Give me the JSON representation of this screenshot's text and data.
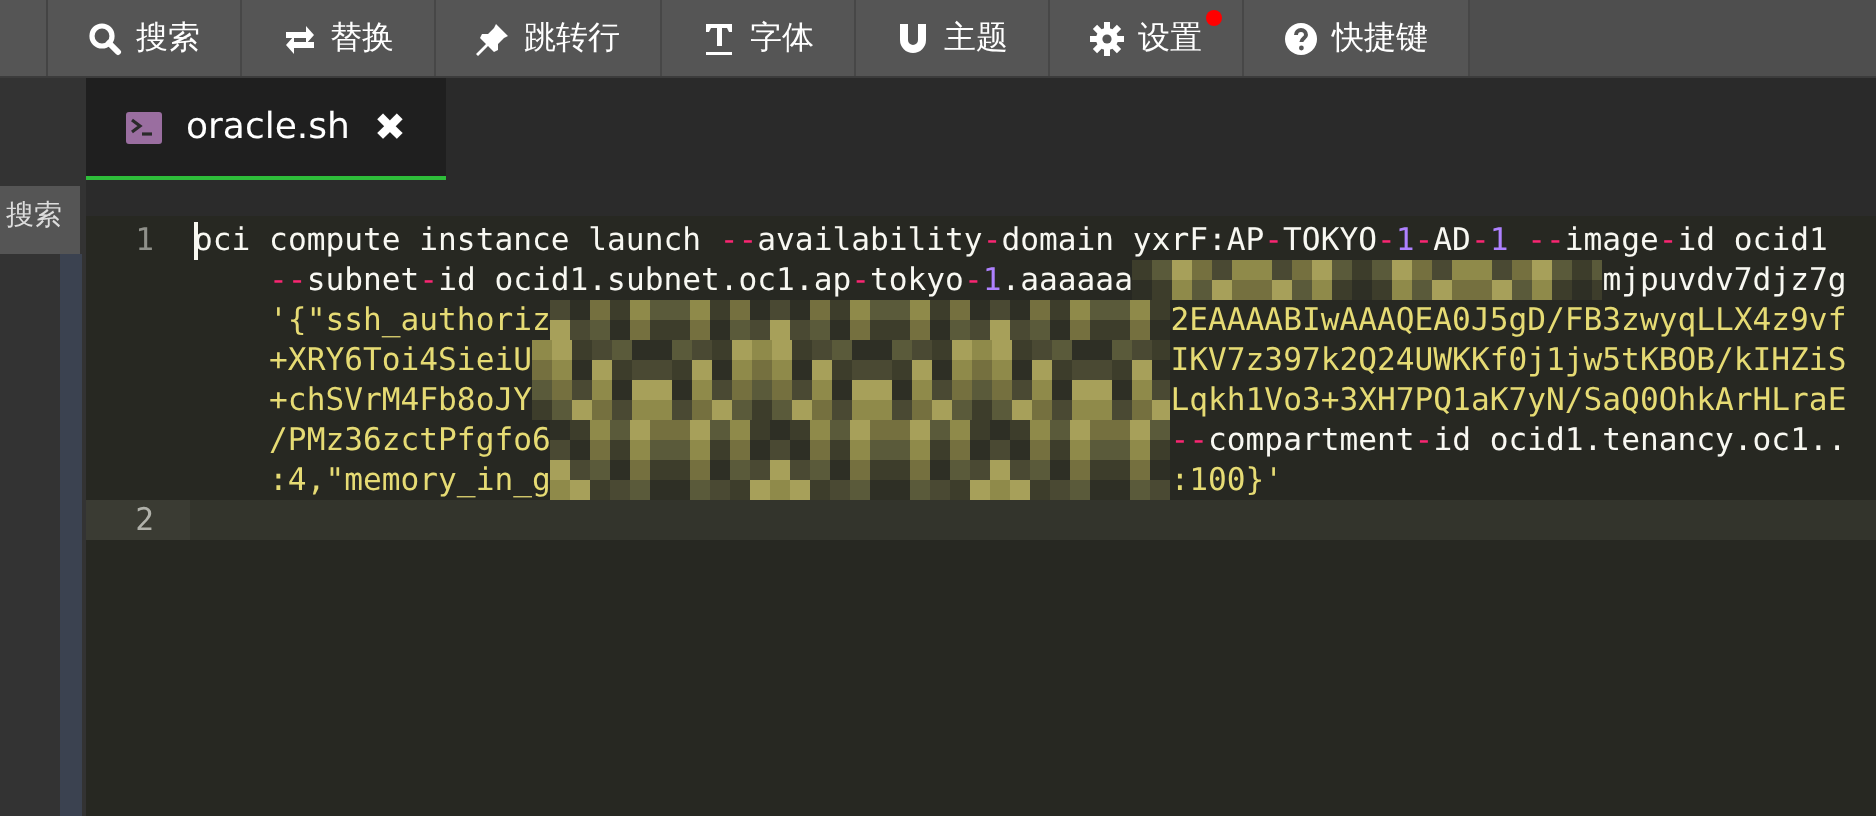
{
  "toolbar": [
    {
      "label": "搜索",
      "badge": false
    },
    {
      "label": "替换",
      "badge": false
    },
    {
      "label": "跳转行",
      "badge": false
    },
    {
      "label": "字体",
      "badge": false
    },
    {
      "label": "主题",
      "badge": false
    },
    {
      "label": "设置",
      "badge": true
    },
    {
      "label": "快捷键",
      "badge": false
    }
  ],
  "tabs": [
    {
      "label": "oracle.sh",
      "close": "✖",
      "selected": true
    }
  ],
  "side_tooltip": "搜索",
  "editor": {
    "lines": [
      {
        "number": "1",
        "active": false,
        "cursor": true,
        "rows": [
          {
            "continuation": false,
            "tokens": [
              {
                "kind": "plain",
                "text": "oci compute instance launch "
              },
              {
                "kind": "operator",
                "text": "--"
              },
              {
                "kind": "plain",
                "text": "availability"
              },
              {
                "kind": "operator",
                "text": "-"
              },
              {
                "kind": "plain",
                "text": "domain yxrF:AP"
              },
              {
                "kind": "operator",
                "text": "-"
              },
              {
                "kind": "plain",
                "text": "TOKYO"
              },
              {
                "kind": "operator",
                "text": "-"
              },
              {
                "kind": "number",
                "text": "1"
              },
              {
                "kind": "operator",
                "text": "-"
              },
              {
                "kind": "plain",
                "text": "AD"
              },
              {
                "kind": "operator",
                "text": "-"
              },
              {
                "kind": "number",
                "text": "1"
              },
              {
                "kind": "operator",
                "text": " --"
              },
              {
                "kind": "plain",
                "text": "image"
              },
              {
                "kind": "operator",
                "text": "-"
              },
              {
                "kind": "plain",
                "text": "id ocid1"
              }
            ]
          },
          {
            "continuation": true,
            "tokens": [
              {
                "kind": "operator",
                "text": "--"
              },
              {
                "kind": "plain",
                "text": "subnet"
              },
              {
                "kind": "operator",
                "text": "-"
              },
              {
                "kind": "plain",
                "text": "id ocid1.subnet.oc1.ap"
              },
              {
                "kind": "operator",
                "text": "-"
              },
              {
                "kind": "plain",
                "text": "tokyo"
              },
              {
                "kind": "operator",
                "text": "-"
              },
              {
                "kind": "number",
                "text": "1"
              },
              {
                "kind": "plain",
                "text": ".aaaaaa"
              },
              {
                "kind": "redacted"
              },
              {
                "kind": "plain",
                "text": "mjpuvdv7djz7g"
              }
            ]
          },
          {
            "continuation": true,
            "tokens": [
              {
                "kind": "string",
                "text": "'{\"ssh_authoriz"
              },
              {
                "kind": "redacted"
              },
              {
                "kind": "string",
                "text": "2EAAAABIwAAAQEA0J5gD/FB3zwyqLLX4z9vf"
              }
            ]
          },
          {
            "continuation": true,
            "tokens": [
              {
                "kind": "string",
                "text": "+XRY6Toi4SieiU"
              },
              {
                "kind": "redacted"
              },
              {
                "kind": "string",
                "text": "IKV7z397k2Q24UWKKf0j1jw5tKBOB/kIHZiS"
              }
            ]
          },
          {
            "continuation": true,
            "tokens": [
              {
                "kind": "string",
                "text": "+chSVrM4Fb8oJY"
              },
              {
                "kind": "redacted"
              },
              {
                "kind": "string",
                "text": "Lqkh1Vo3+3XH7PQ1aK7yN/SaQ0OhkArHLraE"
              }
            ]
          },
          {
            "continuation": true,
            "tokens": [
              {
                "kind": "string",
                "text": "/PMz36zctPfgfo6"
              },
              {
                "kind": "redacted"
              },
              {
                "kind": "operator",
                "text": "--"
              },
              {
                "kind": "plain",
                "text": "compartment"
              },
              {
                "kind": "operator",
                "text": "-"
              },
              {
                "kind": "plain",
                "text": "id ocid1.tenancy.oc1.."
              }
            ]
          },
          {
            "continuation": true,
            "tokens": [
              {
                "kind": "string",
                "text": ":4,\"memory_in_g"
              },
              {
                "kind": "redacted"
              },
              {
                "kind": "string",
                "text": ":100}'"
              }
            ]
          }
        ]
      },
      {
        "number": "2",
        "active": true,
        "cursor": false
      }
    ]
  }
}
